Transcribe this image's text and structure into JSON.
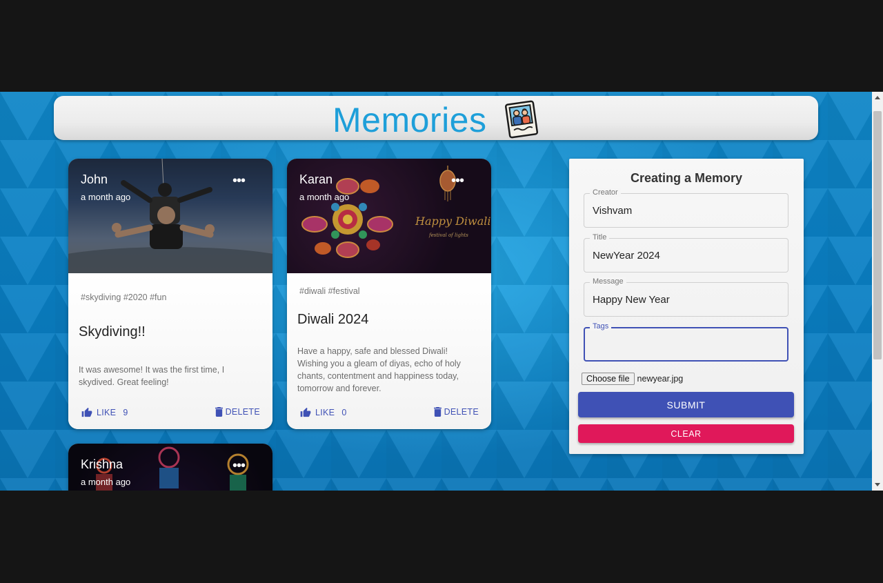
{
  "app": {
    "title": "Memories",
    "logo_icon": "photo-memories-icon",
    "accent": "#1e9fd9"
  },
  "posts": [
    {
      "author": "John",
      "time": "a month ago",
      "tags": "#skydiving #2020 #fun",
      "title": "Skydiving!!",
      "message": "It was awesome! It was the first time, I skydived. Great feeling!",
      "like_label": "LIKE",
      "like_count": "9",
      "delete_label": "DELETE",
      "more_label": "•••"
    },
    {
      "author": "Karan",
      "time": "a month ago",
      "tags": "#diwali #festival",
      "title": "Diwali 2024",
      "message": "Have a happy, safe and blessed Diwali! Wishing you a gleam of diyas, echo of holy chants, contentment and happiness today, tomorrow and forever.",
      "image_text": "Happy Diwali",
      "image_subtext": "festival of lights",
      "like_label": "LIKE",
      "like_count": "0",
      "delete_label": "DELETE",
      "more_label": "•••"
    },
    {
      "author": "Krishna",
      "time": "a month ago",
      "more_label": "•••"
    }
  ],
  "form": {
    "title": "Creating a Memory",
    "creator": {
      "label": "Creator",
      "value": "Vishvam"
    },
    "post_title": {
      "label": "Title",
      "value": "NewYear 2024"
    },
    "message": {
      "label": "Message",
      "value": "Happy New Year"
    },
    "tags": {
      "label": "Tags",
      "value": ""
    },
    "file": {
      "button": "Choose file",
      "name": "newyear.jpg"
    },
    "submit_label": "SUBMIT",
    "clear_label": "CLEAR",
    "colors": {
      "primary": "#3f51b5",
      "secondary": "#e0185a"
    }
  }
}
